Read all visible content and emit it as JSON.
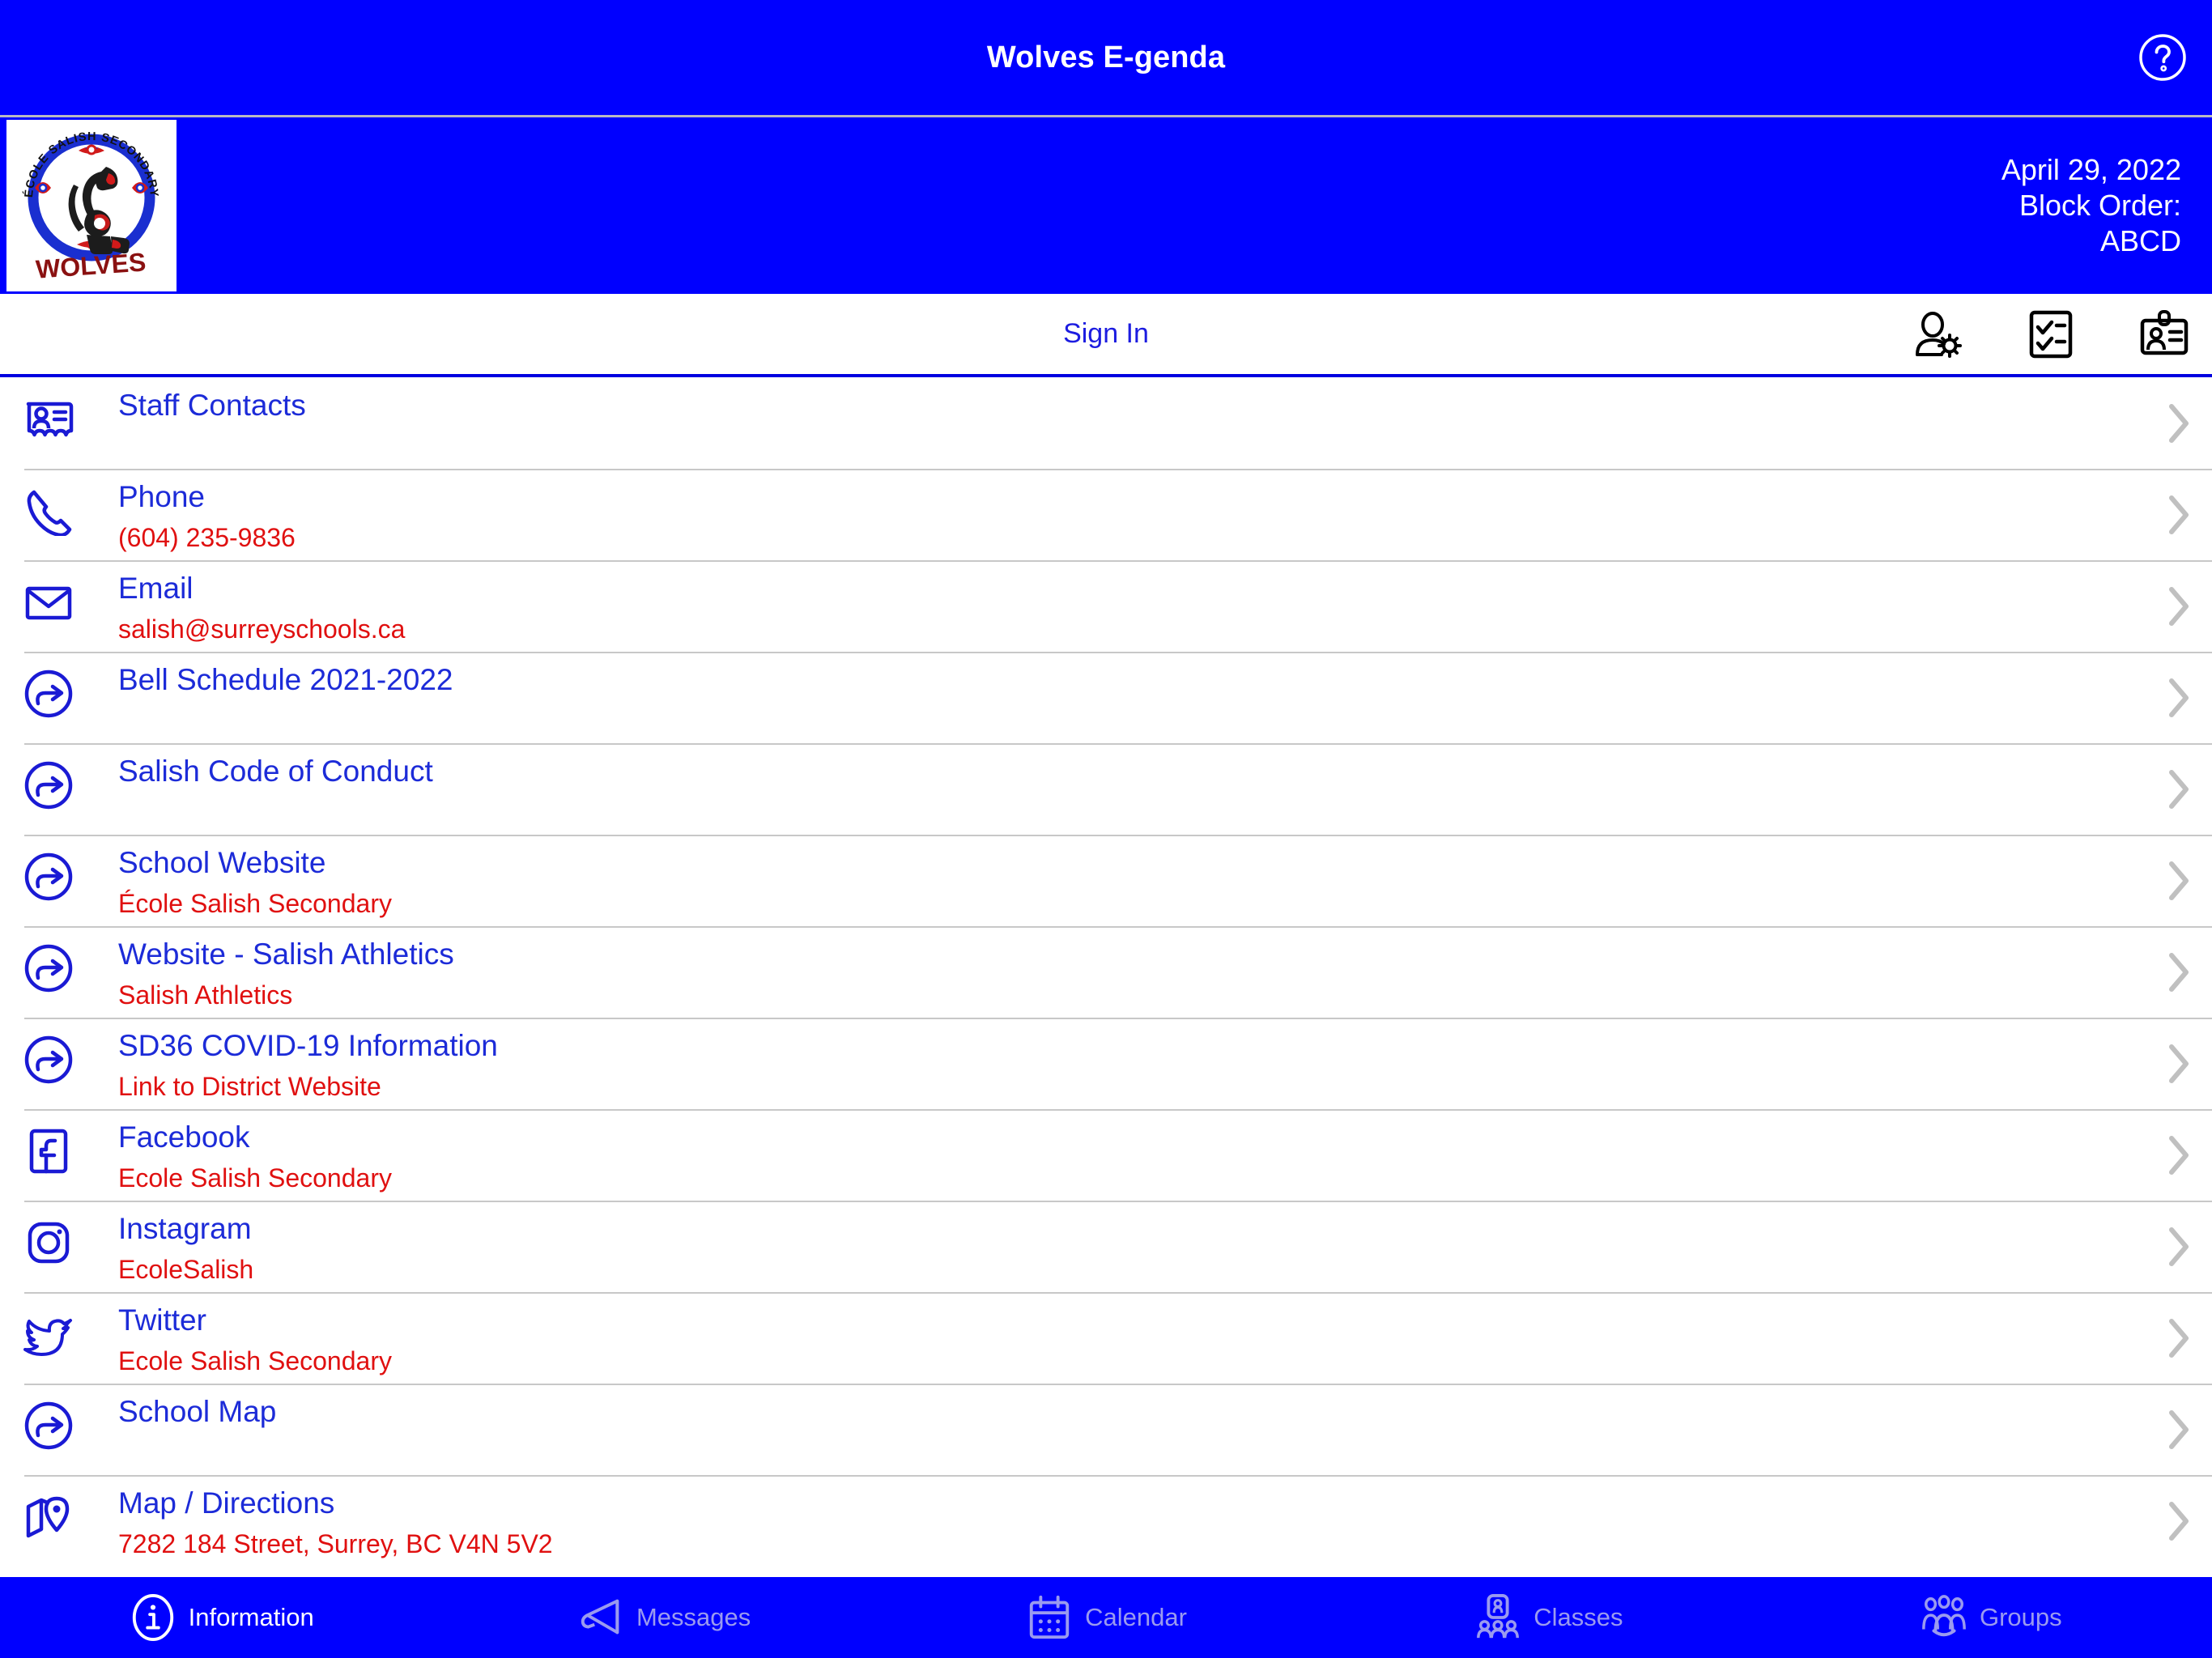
{
  "titlebar": {
    "title": "Wolves E-genda",
    "help_icon": "question-mark-circle-icon"
  },
  "header": {
    "logo": {
      "top_text": "ÉCOLE SALISH SECONDARY",
      "bottom_text": "WOLVES",
      "alt": "Ecole Salish Secondary Wolves crest"
    },
    "date": "April 29, 2022",
    "block_order_label": "Block Order:",
    "block_order_value": "ABCD"
  },
  "toolbar": {
    "sign_in_label": "Sign In",
    "icons": [
      {
        "name": "user-settings-icon"
      },
      {
        "name": "checklist-icon"
      },
      {
        "name": "id-badge-icon"
      }
    ]
  },
  "list": {
    "items": [
      {
        "icon": "contact-card-icon",
        "label": "Staff Contacts",
        "sub": ""
      },
      {
        "icon": "phone-icon",
        "label": "Phone",
        "sub": "(604) 235-9836"
      },
      {
        "icon": "email-icon",
        "label": "Email",
        "sub": "salish@surreyschools.ca"
      },
      {
        "icon": "external-link-icon",
        "label": "Bell Schedule 2021-2022",
        "sub": ""
      },
      {
        "icon": "external-link-icon",
        "label": "Salish Code of Conduct",
        "sub": ""
      },
      {
        "icon": "external-link-icon",
        "label": "School Website",
        "sub": "École Salish Secondary"
      },
      {
        "icon": "external-link-icon",
        "label": "Website - Salish Athletics",
        "sub": "Salish Athletics"
      },
      {
        "icon": "external-link-icon",
        "label": "SD36 COVID-19 Information",
        "sub": "Link to District Website"
      },
      {
        "icon": "facebook-icon",
        "label": "Facebook",
        "sub": "Ecole Salish Secondary"
      },
      {
        "icon": "instagram-icon",
        "label": "Instagram",
        "sub": "EcoleSalish"
      },
      {
        "icon": "twitter-icon",
        "label": "Twitter",
        "sub": "Ecole Salish Secondary"
      },
      {
        "icon": "external-link-icon",
        "label": "School Map",
        "sub": ""
      },
      {
        "icon": "map-pin-icon",
        "label": "Map / Directions",
        "sub": "7282 184 Street, Surrey, BC V4N 5V2"
      }
    ]
  },
  "tabbar": {
    "tabs": [
      {
        "icon": "information-icon",
        "label": "Information",
        "active": true
      },
      {
        "icon": "megaphone-icon",
        "label": "Messages",
        "active": false
      },
      {
        "icon": "calendar-icon",
        "label": "Calendar",
        "active": false
      },
      {
        "icon": "classes-icon",
        "label": "Classes",
        "active": false
      },
      {
        "icon": "groups-icon",
        "label": "Groups",
        "active": false
      }
    ]
  },
  "colors": {
    "brand_blue": "#0000FF",
    "label_blue": "#1C2BD8",
    "sub_red": "#E01010",
    "separator": "#C8C8C8",
    "tab_inactive": "#9A9AEF"
  }
}
